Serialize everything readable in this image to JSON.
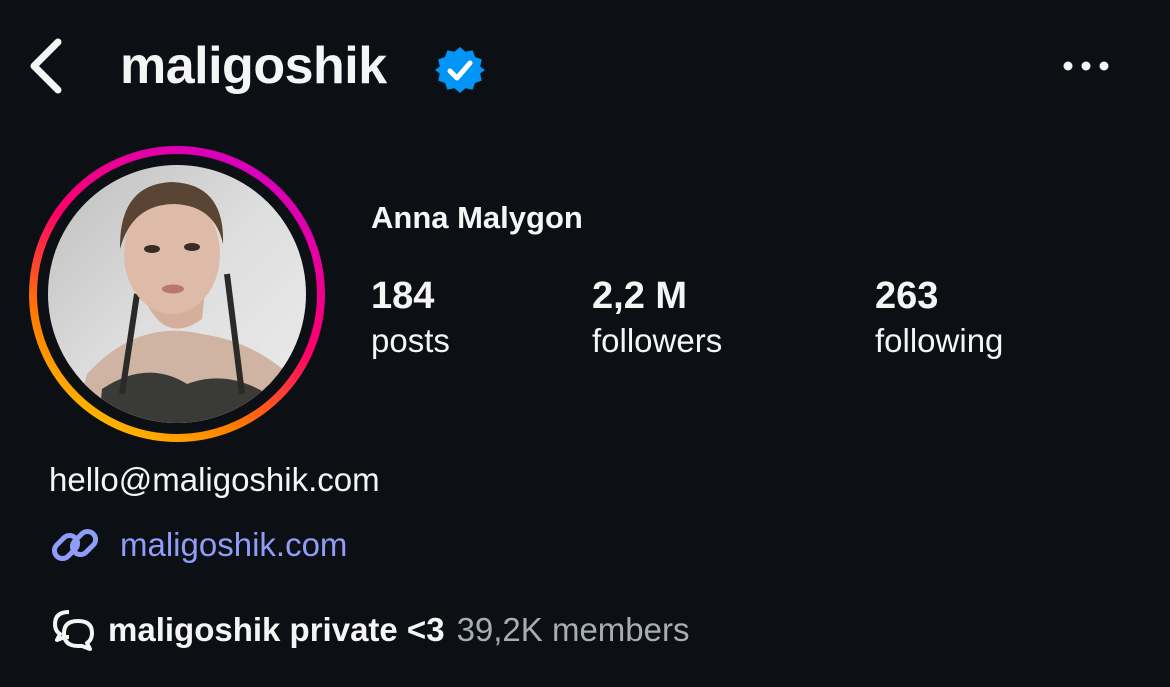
{
  "header": {
    "username": "maligoshik",
    "verified": true
  },
  "profile": {
    "display_name": "Anna Malygon",
    "avatar": "profile-photo-with-story-ring"
  },
  "stats": [
    {
      "value": "184",
      "label": "posts"
    },
    {
      "value": "2,2 M",
      "label": "followers"
    },
    {
      "value": "263",
      "label": "following"
    }
  ],
  "bio": {
    "email": "hello@maligoshik.com",
    "link_text": "maligoshik.com",
    "channel_name": "maligoshik private <3",
    "channel_members": "39,2K members"
  },
  "icons": {
    "back": "chevron-left-icon",
    "verified": "verified-badge-icon",
    "more": "more-options-icon",
    "link": "link-icon",
    "channel": "broadcast-channel-icon"
  },
  "colors": {
    "background": "#0c1014",
    "text": "#f5f5f5",
    "verified_blue": "#0095f6",
    "link": "#8f9cf8",
    "muted": "#a8adb4",
    "story_ring_top": "#d300c5",
    "story_ring_bottom": "#ffc600"
  }
}
